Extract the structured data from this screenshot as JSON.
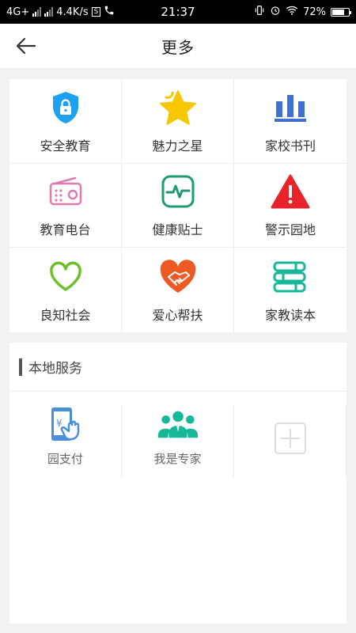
{
  "status_bar": {
    "network": "4G+",
    "speed": "4.4K/s",
    "s_badge": "S",
    "time": "21:37",
    "battery": "72%"
  },
  "header": {
    "title": "更多"
  },
  "grid": {
    "items": [
      {
        "label": "安全教育",
        "icon": "shield-lock-icon"
      },
      {
        "label": "魅力之星",
        "icon": "star-icon"
      },
      {
        "label": "家校书刊",
        "icon": "books-icon"
      },
      {
        "label": "教育电台",
        "icon": "radio-icon"
      },
      {
        "label": "健康贴士",
        "icon": "heartbeat-icon"
      },
      {
        "label": "警示园地",
        "icon": "warning-icon"
      },
      {
        "label": "良知社会",
        "icon": "heart-outline-icon"
      },
      {
        "label": "爱心帮扶",
        "icon": "heart-handshake-icon"
      },
      {
        "label": "家教读本",
        "icon": "book-stack-icon"
      }
    ]
  },
  "local_services": {
    "title": "本地服务",
    "items": [
      {
        "label": "园支付",
        "icon": "mobile-payment-icon"
      },
      {
        "label": "我是专家",
        "icon": "experts-icon"
      }
    ],
    "add_icon": "add-icon"
  },
  "colors": {
    "blue": "#1da1f2",
    "yellow": "#f7c800",
    "indigo": "#3f6fd1",
    "pink": "#e07bb0",
    "teal": "#1f9a77",
    "red": "#e8232a",
    "green": "#6cc12a",
    "orange": "#ee5a24",
    "mint": "#17b89a"
  }
}
